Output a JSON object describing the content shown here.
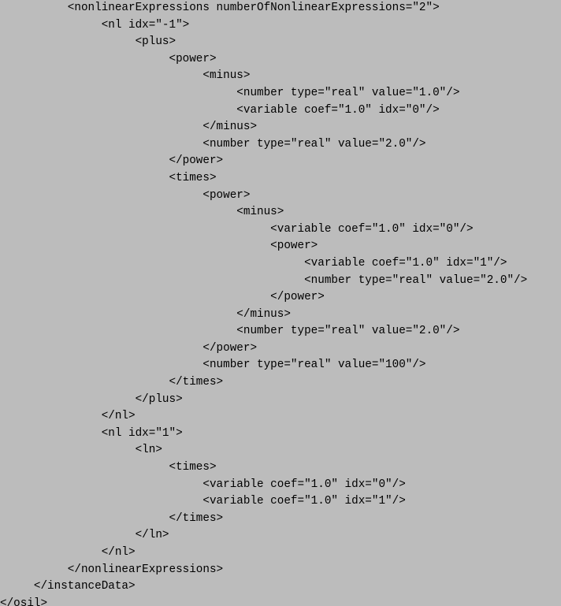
{
  "lines": [
    "          <nonlinearExpressions numberOfNonlinearExpressions=\"2\">",
    "               <nl idx=\"-1\">",
    "                    <plus>",
    "                         <power>",
    "                              <minus>",
    "                                   <number type=\"real\" value=\"1.0\"/>",
    "                                   <variable coef=\"1.0\" idx=\"0\"/>",
    "                              </minus>",
    "                              <number type=\"real\" value=\"2.0\"/>",
    "                         </power>",
    "                         <times>",
    "                              <power>",
    "                                   <minus>",
    "                                        <variable coef=\"1.0\" idx=\"0\"/>",
    "                                        <power>",
    "                                             <variable coef=\"1.0\" idx=\"1\"/>",
    "                                             <number type=\"real\" value=\"2.0\"/>",
    "                                        </power>",
    "                                   </minus>",
    "                                   <number type=\"real\" value=\"2.0\"/>",
    "                              </power>",
    "                              <number type=\"real\" value=\"100\"/>",
    "                         </times>",
    "                    </plus>",
    "               </nl>",
    "               <nl idx=\"1\">",
    "                    <ln>",
    "                         <times>",
    "                              <variable coef=\"1.0\" idx=\"0\"/>",
    "                              <variable coef=\"1.0\" idx=\"1\"/>",
    "                         </times>",
    "                    </ln>",
    "               </nl>",
    "          </nonlinearExpressions>",
    "     </instanceData>",
    "</osil>"
  ]
}
